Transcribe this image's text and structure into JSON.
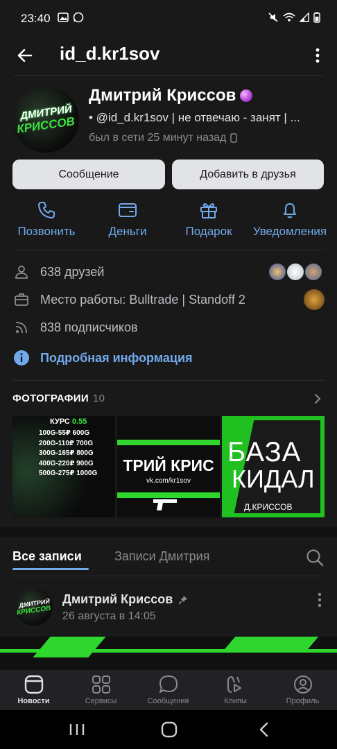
{
  "statusbar": {
    "time": "23:40"
  },
  "topbar": {
    "title": "id_d.kr1sov"
  },
  "profile": {
    "avatar_text_1": "ДМИТРИЙ",
    "avatar_text_2": "КРИССОВ",
    "name": "Дмитрий Криссов",
    "status": "• @id_d.kr1sov | не отвечаю - занят | ...",
    "online": "был в сети 25 минут назад"
  },
  "buttons": {
    "message": "Сообщение",
    "add_friend": "Добавить в друзья"
  },
  "actions": [
    {
      "label": "Позвонить"
    },
    {
      "label": "Деньги"
    },
    {
      "label": "Подарок"
    },
    {
      "label": "Уведомления"
    }
  ],
  "info": {
    "friends": "638 друзей",
    "work": "Место работы: Bulltrade | Standoff 2",
    "followers": "838 подписчиков",
    "details": "Подробная информация"
  },
  "photos": {
    "title": "ФОТОГРАФИИ",
    "count": "10",
    "p1_title": "КУРС",
    "p1_rate": "0.55",
    "p1_rows": [
      "100G-55₽ 600G",
      "200G-110₽ 700G",
      "300G-165₽ 800G",
      "400G-220₽ 900G",
      "500G-275₽ 1000G"
    ],
    "p2_text": "ТРИЙ КРИС",
    "p2_link": "vk.com/kr1sov",
    "p3_line1": "БАЗА",
    "p3_line2": "КИДАЛ",
    "p3_sign": "Д.КРИССОВ"
  },
  "tabs": {
    "all": "Все записи",
    "dmitry": "Записи Дмитрия"
  },
  "post": {
    "author": "Дмитрий Криссов",
    "date": "26 августа в 14:05"
  },
  "nav": [
    {
      "label": "Новости"
    },
    {
      "label": "Сервисы"
    },
    {
      "label": "Сообщения"
    },
    {
      "label": "Клипы"
    },
    {
      "label": "Профиль"
    }
  ],
  "colors": {
    "accent": "#71aaeb",
    "background": "#19191a",
    "green": "#39e33f"
  }
}
